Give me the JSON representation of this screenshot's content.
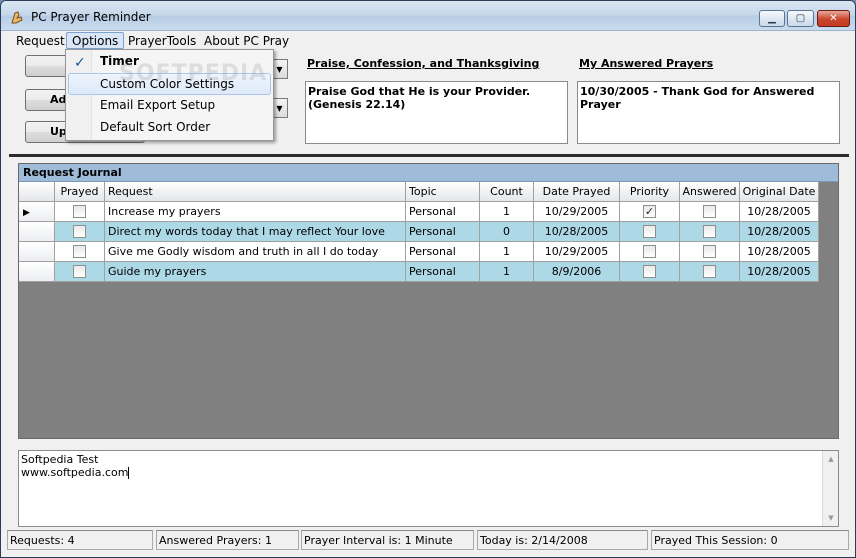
{
  "window": {
    "title": "PC Prayer Reminder"
  },
  "menu": [
    "Request",
    "Options",
    "PrayerTools",
    "About PC Pray"
  ],
  "options_menu": {
    "items": [
      {
        "label": "Timer",
        "checked": true
      },
      {
        "label": "Custom Color Settings",
        "checked": false
      },
      {
        "label": "Email Export Setup",
        "checked": false
      },
      {
        "label": "Default Sort Order",
        "checked": false
      }
    ]
  },
  "left_buttons": [
    "Ad",
    "Upda"
  ],
  "praise": {
    "label": "Praise, Confession, and Thanksgiving",
    "text": "Praise God that He is your Provider. (Genesis 22.14)"
  },
  "answered": {
    "label": "My Answered Prayers",
    "text": "10/30/2005 - Thank God for Answered Prayer"
  },
  "journal": {
    "caption": "Request Journal",
    "columns": [
      "Prayed",
      "Request",
      "Topic",
      "Count",
      "Date Prayed",
      "Priority",
      "Answered",
      "Original Date"
    ],
    "rows": [
      {
        "prayed": false,
        "request": "Increase my prayers",
        "topic": "Personal",
        "count": "1",
        "date_prayed": "10/29/2005",
        "priority": true,
        "answered": false,
        "original_date": "10/28/2005"
      },
      {
        "prayed": false,
        "request": "Direct my words today that I may reflect Your love",
        "topic": "Personal",
        "count": "0",
        "date_prayed": "10/28/2005",
        "priority": false,
        "answered": false,
        "original_date": "10/28/2005"
      },
      {
        "prayed": false,
        "request": "Give me Godly wisdom and truth in all I do today",
        "topic": "Personal",
        "count": "1",
        "date_prayed": "10/29/2005",
        "priority": false,
        "answered": false,
        "original_date": "10/28/2005"
      },
      {
        "prayed": false,
        "request": "Guide my prayers",
        "topic": "Personal",
        "count": "1",
        "date_prayed": "8/9/2006",
        "priority": false,
        "answered": false,
        "original_date": "10/28/2005"
      }
    ],
    "current_row_marker": "▶"
  },
  "notes": {
    "line1": "Softpedia Test",
    "line2": "www.softpedia.com"
  },
  "status": {
    "requests": "Requests: 4",
    "answered": "Answered Prayers: 1",
    "interval": "Prayer Interval is: 1 Minute",
    "today": "Today is: 2/14/2008",
    "session": "Prayed This Session: 0"
  },
  "watermark": "SOFTPEDIA",
  "colors": {
    "row_alt": "#add8e6",
    "caption": "#9ebbd9",
    "grid_bg": "#808080"
  },
  "icons": {
    "check": "✓",
    "minimize": "▁",
    "maximize": "▢",
    "close": "✕",
    "combo_arrow": "▼",
    "scroll_up": "▲",
    "scroll_down": "▼"
  }
}
